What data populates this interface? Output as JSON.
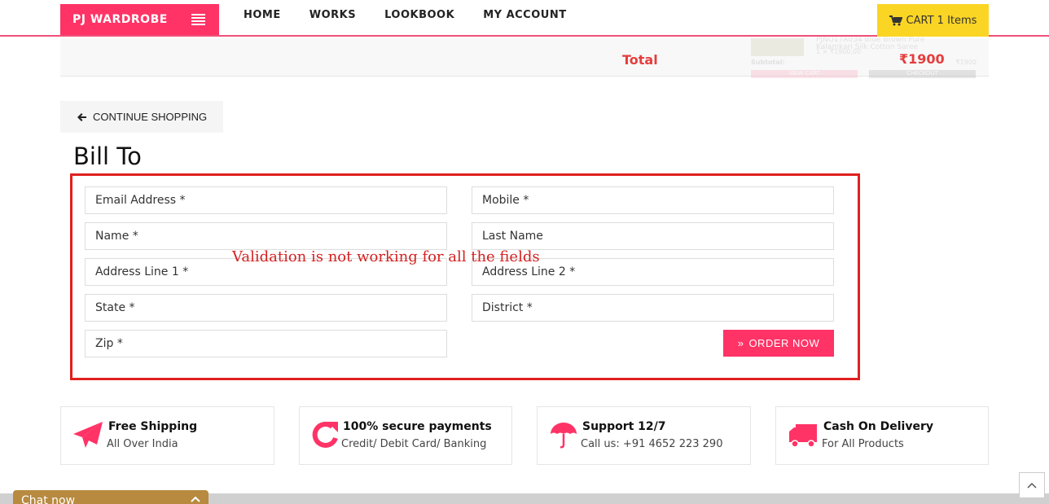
{
  "header": {
    "brand": "PJ WARDROBE",
    "nav": [
      "HOME",
      "WORKS",
      "LOOKBOOK",
      "MY ACCOUNT"
    ],
    "cart_label": "CART 1 Items"
  },
  "summary": {
    "total_label": "Total",
    "total_value": "₹1900"
  },
  "mini_cart": {
    "item_title": "PJNO17A034 Blue Brown Pure Kalamkari Silk Cotton Saree",
    "item_price": "1 × ₹1900.00",
    "subtotal_label": "Subtotal:",
    "subtotal_value": "₹1900",
    "view_cart": "VIEW CART",
    "checkout": "CHECKOUT"
  },
  "continue_label": "CONTINUE SHOPPING",
  "bill_to": {
    "title": "Bill To",
    "fields": {
      "email": "Email Address *",
      "mobile": "Mobile *",
      "name": "Name *",
      "last_name": "Last Name",
      "address1": "Address Line 1 *",
      "address2": "Address Line 2 *",
      "state": "State *",
      "district": "District *",
      "zip": "Zip *"
    },
    "order_button": "ORDER NOW"
  },
  "annotation": "Validation is not working for all the fields",
  "features": [
    {
      "title": "Free Shipping",
      "subtitle": "All Over India",
      "icon": "paper-plane-icon"
    },
    {
      "title": "100% secure payments",
      "subtitle": "Credit/ Debit Card/ Banking",
      "icon": "refresh-icon"
    },
    {
      "title": "Support 12/7",
      "subtitle": "Call us: +91 4652 223 290",
      "icon": "umbrella-icon"
    },
    {
      "title": "Cash On Delivery",
      "subtitle": "For All Products",
      "icon": "truck-icon"
    }
  ],
  "chat_label": "Chat now",
  "colors": {
    "accent": "#ff3366",
    "cart": "#fbd524",
    "annotation_red": "#e02020",
    "total_red": "#e53d3d"
  }
}
